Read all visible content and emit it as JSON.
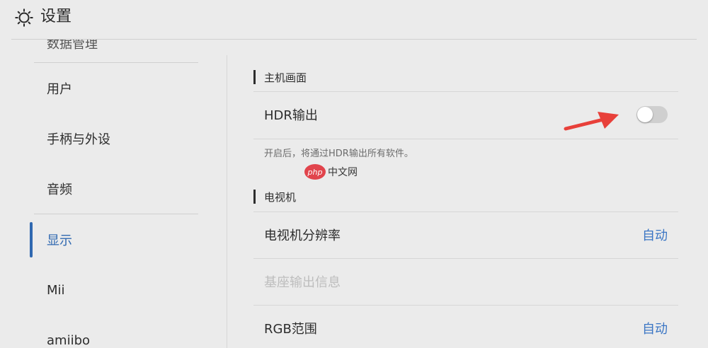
{
  "header": {
    "title": "设置",
    "icon": "gear-icon"
  },
  "sidebar": {
    "items": [
      {
        "label": "数据管理",
        "partial": true
      },
      {
        "label": "用户"
      },
      {
        "label": "手柄与外设"
      },
      {
        "label": "音频"
      },
      {
        "label": "显示",
        "active": true
      },
      {
        "label": "Mii"
      },
      {
        "label": "amiibo"
      }
    ]
  },
  "content": {
    "sections": [
      {
        "title": "主机画面",
        "rows": [
          {
            "label": "HDR输出",
            "control": "toggle",
            "state": "off"
          }
        ],
        "description": "开启后，将通过HDR输出所有软件。"
      },
      {
        "title": "电视机",
        "rows": [
          {
            "label": "电视机分辨率",
            "value": "自动"
          },
          {
            "label": "基座输出信息",
            "disabled": true
          },
          {
            "label": "RGB范围",
            "value": "自动"
          }
        ]
      }
    ]
  },
  "annotation": {
    "arrow_color": "#e8403a"
  },
  "watermark": {
    "badge": "php",
    "text": "中文网"
  },
  "colors": {
    "background": "#ebebeb",
    "accent": "#2f68b0",
    "link_value": "#3a75c4"
  }
}
